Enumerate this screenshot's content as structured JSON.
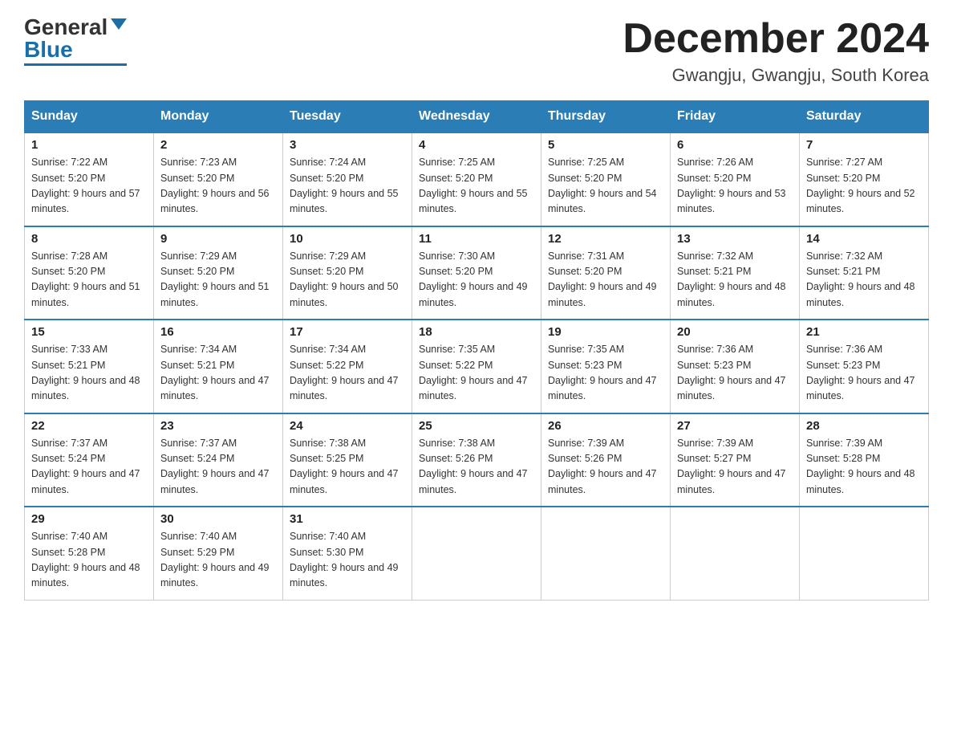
{
  "logo": {
    "general": "General",
    "blue": "Blue"
  },
  "title": "December 2024",
  "location": "Gwangju, Gwangju, South Korea",
  "days_of_week": [
    "Sunday",
    "Monday",
    "Tuesday",
    "Wednesday",
    "Thursday",
    "Friday",
    "Saturday"
  ],
  "weeks": [
    [
      {
        "day": "1",
        "sunrise": "7:22 AM",
        "sunset": "5:20 PM",
        "daylight": "9 hours and 57 minutes."
      },
      {
        "day": "2",
        "sunrise": "7:23 AM",
        "sunset": "5:20 PM",
        "daylight": "9 hours and 56 minutes."
      },
      {
        "day": "3",
        "sunrise": "7:24 AM",
        "sunset": "5:20 PM",
        "daylight": "9 hours and 55 minutes."
      },
      {
        "day": "4",
        "sunrise": "7:25 AM",
        "sunset": "5:20 PM",
        "daylight": "9 hours and 55 minutes."
      },
      {
        "day": "5",
        "sunrise": "7:25 AM",
        "sunset": "5:20 PM",
        "daylight": "9 hours and 54 minutes."
      },
      {
        "day": "6",
        "sunrise": "7:26 AM",
        "sunset": "5:20 PM",
        "daylight": "9 hours and 53 minutes."
      },
      {
        "day": "7",
        "sunrise": "7:27 AM",
        "sunset": "5:20 PM",
        "daylight": "9 hours and 52 minutes."
      }
    ],
    [
      {
        "day": "8",
        "sunrise": "7:28 AM",
        "sunset": "5:20 PM",
        "daylight": "9 hours and 51 minutes."
      },
      {
        "day": "9",
        "sunrise": "7:29 AM",
        "sunset": "5:20 PM",
        "daylight": "9 hours and 51 minutes."
      },
      {
        "day": "10",
        "sunrise": "7:29 AM",
        "sunset": "5:20 PM",
        "daylight": "9 hours and 50 minutes."
      },
      {
        "day": "11",
        "sunrise": "7:30 AM",
        "sunset": "5:20 PM",
        "daylight": "9 hours and 49 minutes."
      },
      {
        "day": "12",
        "sunrise": "7:31 AM",
        "sunset": "5:20 PM",
        "daylight": "9 hours and 49 minutes."
      },
      {
        "day": "13",
        "sunrise": "7:32 AM",
        "sunset": "5:21 PM",
        "daylight": "9 hours and 48 minutes."
      },
      {
        "day": "14",
        "sunrise": "7:32 AM",
        "sunset": "5:21 PM",
        "daylight": "9 hours and 48 minutes."
      }
    ],
    [
      {
        "day": "15",
        "sunrise": "7:33 AM",
        "sunset": "5:21 PM",
        "daylight": "9 hours and 48 minutes."
      },
      {
        "day": "16",
        "sunrise": "7:34 AM",
        "sunset": "5:21 PM",
        "daylight": "9 hours and 47 minutes."
      },
      {
        "day": "17",
        "sunrise": "7:34 AM",
        "sunset": "5:22 PM",
        "daylight": "9 hours and 47 minutes."
      },
      {
        "day": "18",
        "sunrise": "7:35 AM",
        "sunset": "5:22 PM",
        "daylight": "9 hours and 47 minutes."
      },
      {
        "day": "19",
        "sunrise": "7:35 AM",
        "sunset": "5:23 PM",
        "daylight": "9 hours and 47 minutes."
      },
      {
        "day": "20",
        "sunrise": "7:36 AM",
        "sunset": "5:23 PM",
        "daylight": "9 hours and 47 minutes."
      },
      {
        "day": "21",
        "sunrise": "7:36 AM",
        "sunset": "5:23 PM",
        "daylight": "9 hours and 47 minutes."
      }
    ],
    [
      {
        "day": "22",
        "sunrise": "7:37 AM",
        "sunset": "5:24 PM",
        "daylight": "9 hours and 47 minutes."
      },
      {
        "day": "23",
        "sunrise": "7:37 AM",
        "sunset": "5:24 PM",
        "daylight": "9 hours and 47 minutes."
      },
      {
        "day": "24",
        "sunrise": "7:38 AM",
        "sunset": "5:25 PM",
        "daylight": "9 hours and 47 minutes."
      },
      {
        "day": "25",
        "sunrise": "7:38 AM",
        "sunset": "5:26 PM",
        "daylight": "9 hours and 47 minutes."
      },
      {
        "day": "26",
        "sunrise": "7:39 AM",
        "sunset": "5:26 PM",
        "daylight": "9 hours and 47 minutes."
      },
      {
        "day": "27",
        "sunrise": "7:39 AM",
        "sunset": "5:27 PM",
        "daylight": "9 hours and 47 minutes."
      },
      {
        "day": "28",
        "sunrise": "7:39 AM",
        "sunset": "5:28 PM",
        "daylight": "9 hours and 48 minutes."
      }
    ],
    [
      {
        "day": "29",
        "sunrise": "7:40 AM",
        "sunset": "5:28 PM",
        "daylight": "9 hours and 48 minutes."
      },
      {
        "day": "30",
        "sunrise": "7:40 AM",
        "sunset": "5:29 PM",
        "daylight": "9 hours and 49 minutes."
      },
      {
        "day": "31",
        "sunrise": "7:40 AM",
        "sunset": "5:30 PM",
        "daylight": "9 hours and 49 minutes."
      },
      null,
      null,
      null,
      null
    ]
  ]
}
